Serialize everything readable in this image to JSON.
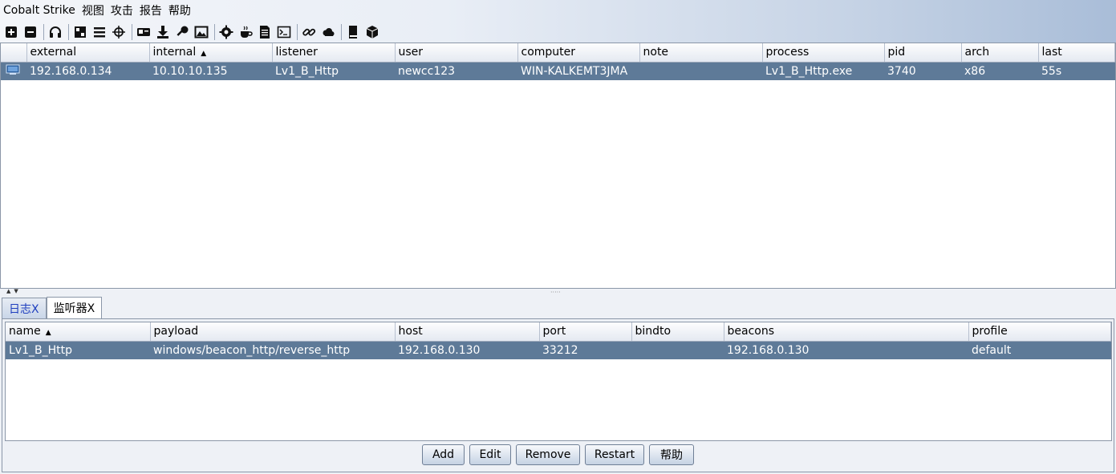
{
  "menu": [
    "Cobalt Strike",
    "视图",
    "攻击",
    "报告",
    "帮助"
  ],
  "toolbar_icons": [
    "new-connection-icon",
    "disconnect-icon",
    "listeners-headphones-icon",
    "pivot-graph-icon",
    "session-table-icon",
    "targets-crosshair-icon",
    "credentials-icon",
    "downloads-icon",
    "keystrokes-key-icon",
    "screenshots-icon",
    "payload-generator-gear-icon",
    "java-applet-icon",
    "web-log-icon",
    "console-icon",
    "manage-links-icon",
    "cloud-icon",
    "help-book-icon",
    "about-box-icon"
  ],
  "sessions": {
    "columns": [
      "",
      "external",
      "internal",
      "listener",
      "user",
      "computer",
      "note",
      "process",
      "pid",
      "arch",
      "last"
    ],
    "sorted_column": "internal",
    "rows": [
      {
        "external": "192.168.0.134",
        "internal": "10.10.10.135",
        "listener": "Lv1_B_Http",
        "user": "newcc123",
        "computer": "WIN-KALKEMT3JMA",
        "note": "",
        "process": "Lv1_B_Http.exe",
        "pid": "3740",
        "arch": "x86",
        "last": "55s"
      }
    ]
  },
  "bottom_tabs": [
    {
      "label": "日志X",
      "active": false
    },
    {
      "label": "监听器X",
      "active": true
    }
  ],
  "listeners": {
    "columns": [
      "name",
      "payload",
      "host",
      "port",
      "bindto",
      "beacons",
      "profile"
    ],
    "sorted_column": "name",
    "rows": [
      {
        "name": "Lv1_B_Http",
        "payload": "windows/beacon_http/reverse_http",
        "host": "192.168.0.130",
        "port": "33212",
        "bindto": "",
        "beacons": "192.168.0.130",
        "profile": "default"
      }
    ]
  },
  "buttons": {
    "add": "Add",
    "edit": "Edit",
    "remove": "Remove",
    "restart": "Restart",
    "help": "帮助"
  },
  "colors": {
    "selection": "#5e7a98",
    "inactive_tab_text": "#1f3fbf"
  }
}
